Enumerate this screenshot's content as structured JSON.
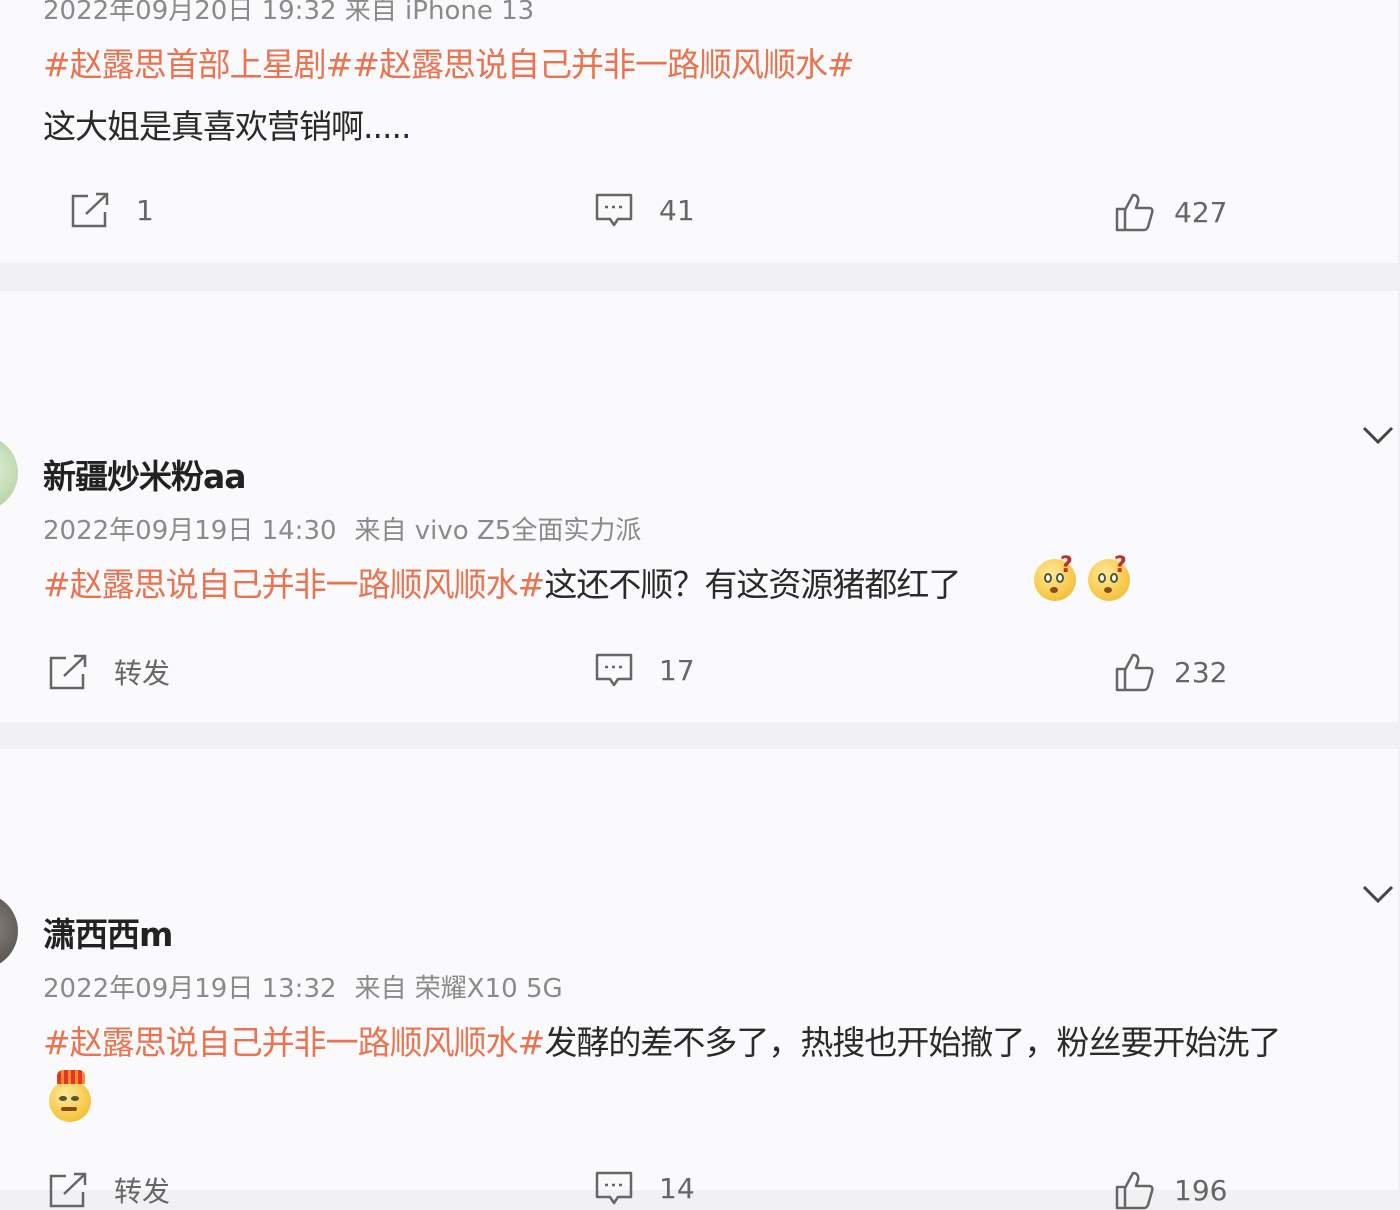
{
  "posts": [
    {
      "meta": "2022年09月20日 19:32  来自 iPhone 13",
      "hashtags": "#赵露思首部上星剧##赵露思说自己并非一路顺风顺水#",
      "text": "这大姐是真喜欢营销啊.....",
      "repost_label": "1",
      "comment_count": "41",
      "like_count": "427"
    },
    {
      "username": "新疆炒米粉aa",
      "meta_date": "2022年09月19日 14:30",
      "meta_source": "来自 vivo Z5全面实力派",
      "hashtags": "#赵露思说自己并非一路顺风顺水#",
      "text": "这还不顺？有这资源猪都红了",
      "emojis": [
        "confused-face-emoji",
        "confused-face-emoji"
      ],
      "repost_label": "转发",
      "comment_count": "17",
      "like_count": "232"
    },
    {
      "username": "潇西西m",
      "meta_date": "2022年09月19日 13:32",
      "meta_source": "来自 荣耀X10 5G",
      "hashtags": "#赵露思说自己并非一路顺风顺水#",
      "text": "发酵的差不多了，热搜也开始撤了，粉丝要开始洗了",
      "emojis": [
        "smug-face-emoji"
      ],
      "repost_label": "转发",
      "comment_count": "14",
      "like_count": "196"
    }
  ],
  "colors": {
    "hashtag": "#eb7350",
    "meta": "#8a8a8a",
    "icon": "#666666"
  }
}
